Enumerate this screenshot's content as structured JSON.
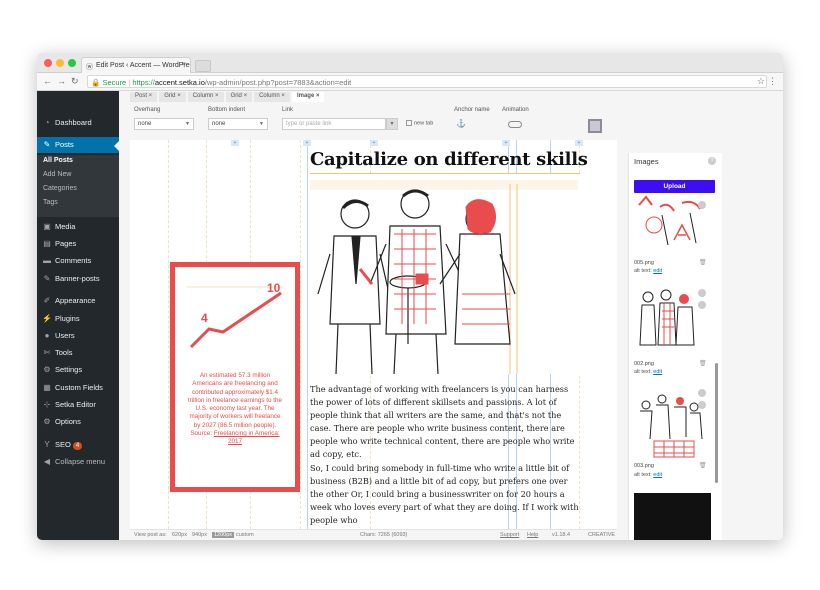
{
  "browser": {
    "tab_title": "Edit Post ‹ Accent — WordPre",
    "tab_close": "×",
    "url_secure": "Secure",
    "url_scheme": "https://",
    "url_host": "accent.setka.io",
    "url_path": "/wp-admin/post.php?post=7883&action=edit"
  },
  "sidebar": {
    "items": [
      {
        "label": "Dashboard",
        "icon": "dashboard-icon"
      },
      {
        "label": "Posts",
        "icon": "pin-icon"
      },
      {
        "label": "Media",
        "icon": "media-icon"
      },
      {
        "label": "Pages",
        "icon": "pages-icon"
      },
      {
        "label": "Comments",
        "icon": "comments-icon"
      },
      {
        "label": "Banner-posts",
        "icon": "pin-icon"
      },
      {
        "label": "Appearance",
        "icon": "brush-icon"
      },
      {
        "label": "Plugins",
        "icon": "plugin-icon"
      },
      {
        "label": "Users",
        "icon": "users-icon"
      },
      {
        "label": "Tools",
        "icon": "wrench-icon"
      },
      {
        "label": "Settings",
        "icon": "settings-icon"
      },
      {
        "label": "Custom Fields",
        "icon": "fields-icon"
      },
      {
        "label": "Setka Editor",
        "icon": "setka-icon"
      },
      {
        "label": "Options",
        "icon": "gear-icon"
      },
      {
        "label": "SEO",
        "icon": "yoast-icon",
        "badge": "4"
      },
      {
        "label": "Collapse menu",
        "icon": "collapse-icon"
      }
    ],
    "posts_sub": [
      "All Posts",
      "Add New",
      "Categories",
      "Tags"
    ]
  },
  "breadcrumbs": [
    "Post",
    "Grid",
    "Column",
    "Grid",
    "Column",
    "Image"
  ],
  "props": {
    "overhang_label": "Overhang",
    "overhang_value": "none",
    "bottom_indent_label": "Bottom indent",
    "bottom_indent_value": "none",
    "link_label": "Link",
    "link_placeholder": "type or paste link",
    "new_tab_label": "new tab",
    "anchor_label": "Anchor name",
    "animation_label": "Animation"
  },
  "article": {
    "heading": "Capitalize on different skills",
    "para1": "The advantage of working with freelancers is you can harness the power of lots of different skillsets and passions. A lot of people think that all writers are the same, and that's not the case. There are people who write business content, there are people who write technical content, there are people who write ad copy, etc.",
    "para2": "So, I could bring somebody in full-time who write a little bit of business (B2B) and a little bit of ad copy, but prefers one over the other Or, I could bring a businesswriter on for 20 hours a week who loves every part of what they are doing. If I work with people who"
  },
  "infographic": {
    "num_small": "4",
    "num_large": "10",
    "text": "An estimated 57.3 million Americans are freelancing and contributed approximately $1.4 trillion in freelance earnings to the U.S. economy last year. The majority of workers will freelance by 2027 (86.5 million people).",
    "source_prefix": "Source: ",
    "source_link": "Freelancing in America: 2017"
  },
  "statusbar": {
    "view_label": "View post as:",
    "v1": "620px",
    "v2": "940px",
    "v3": "1200px",
    "v4": "custom",
    "chars": "Chars: 7265 (6093)",
    "support": "Support",
    "help": "Help",
    "version": "v1.18.4",
    "creative": "CREATIVE"
  },
  "images_panel": {
    "title": "Images",
    "help": "?",
    "upload": "Upload",
    "items": [
      {
        "file": "005.png",
        "alt_prefix": "alt text: ",
        "alt_link": "edit"
      },
      {
        "file": "002.png",
        "alt_prefix": "alt text: ",
        "alt_link": "edit"
      },
      {
        "file": "003.png",
        "alt_prefix": "alt text: ",
        "alt_link": "edit"
      }
    ]
  },
  "colors": {
    "accent": "#e84c4c",
    "wp_blue": "#0073aa",
    "upload_blue": "#3d0ef2",
    "sidebar_bg": "#23282d"
  }
}
